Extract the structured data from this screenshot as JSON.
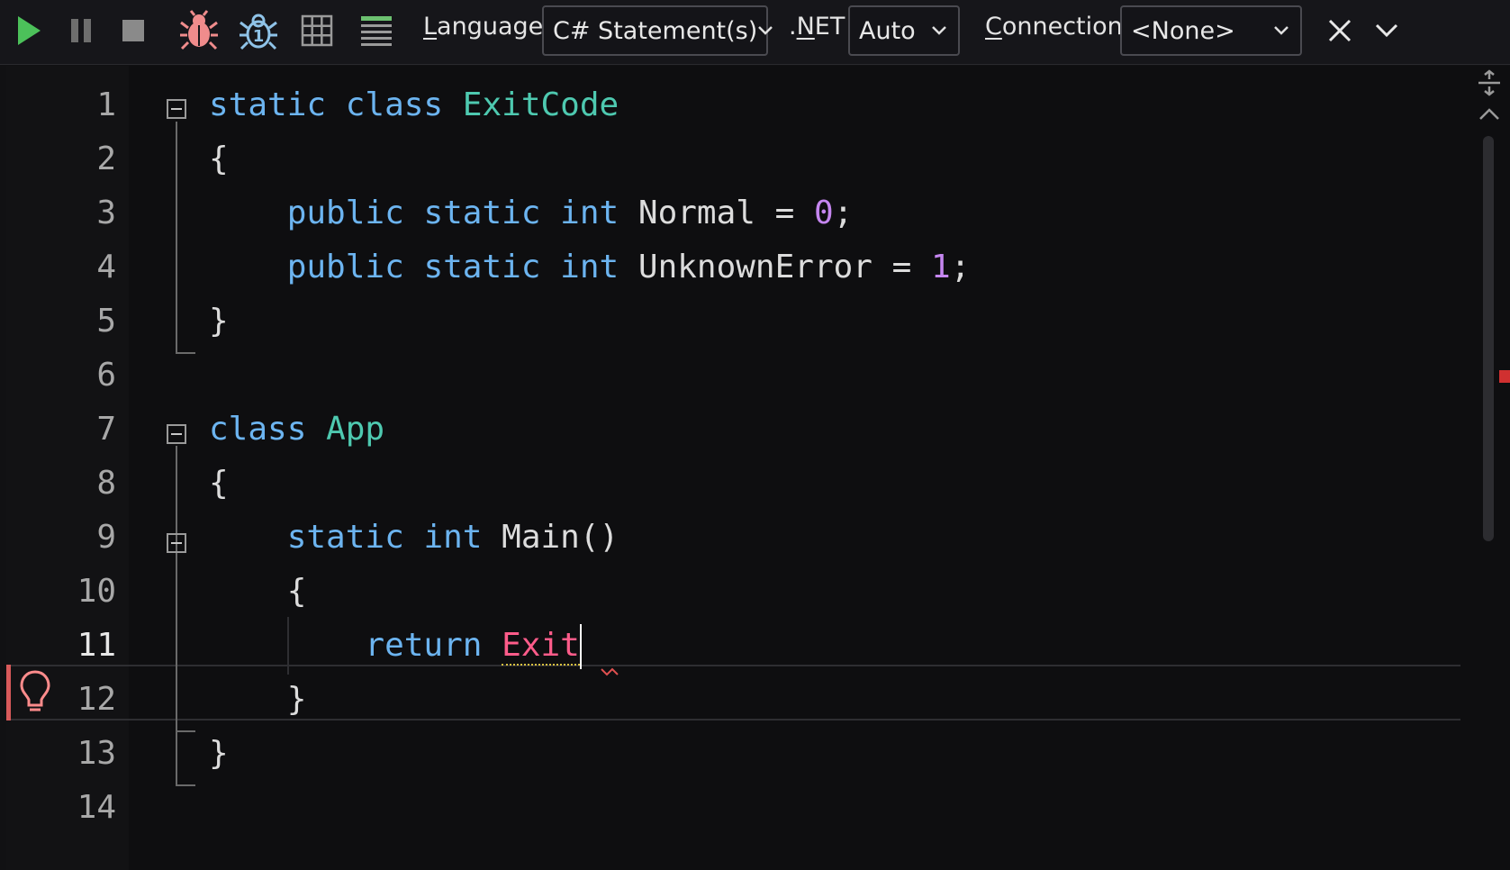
{
  "toolbar": {
    "language_label": "Language",
    "language_label_access": "L",
    "language_label_rest": "anguage",
    "language_value": "C# Statement(s)",
    "net_label": ".NET",
    "net_label_access": "N",
    "net_label_pre": ".",
    "net_label_rest": "ET",
    "net_value": "Auto",
    "connection_label": "Connection",
    "connection_label_access": "C",
    "connection_label_rest": "onnection",
    "connection_value": "<None>"
  },
  "icons": {
    "run": "play-icon",
    "pause": "pause-icon",
    "stop": "stop-icon",
    "debug": "bug-icon",
    "debug_step": "bug-step-icon",
    "grid": "grid-results-icon",
    "text": "text-results-icon",
    "close": "close-icon",
    "expand": "chevron-down-icon"
  },
  "colors": {
    "run_green": "#4cc15a",
    "keyword": "#6cb4f0",
    "type": "#4ec9b0",
    "number": "#c586f0",
    "error": "#ff5c8a",
    "bulb": "#ff8c8c"
  },
  "editor": {
    "lines": [
      {
        "n": "1"
      },
      {
        "n": "2"
      },
      {
        "n": "3"
      },
      {
        "n": "4"
      },
      {
        "n": "5"
      },
      {
        "n": "6"
      },
      {
        "n": "7"
      },
      {
        "n": "8"
      },
      {
        "n": "9"
      },
      {
        "n": "10"
      },
      {
        "n": "11"
      },
      {
        "n": "12"
      },
      {
        "n": "13"
      },
      {
        "n": "14"
      }
    ],
    "code": {
      "l1_static": "static",
      "l1_class": "class",
      "l1_name": "ExitCode",
      "l2": "{",
      "l3_public": "public",
      "l3_static": "static",
      "l3_int": "int",
      "l3_rest": "Normal = ",
      "l3_num": "0",
      "l3_end": ";",
      "l4_public": "public",
      "l4_static": "static",
      "l4_int": "int",
      "l4_rest": "UnknownError = ",
      "l4_num": "1",
      "l4_end": ";",
      "l5": "}",
      "l7_class": "class",
      "l7_name": "App",
      "l8": "{",
      "l9_static": "static",
      "l9_int": "int",
      "l9_rest": "Main()",
      "l10": "{",
      "l11_return": "return",
      "l11_err": "Exit",
      "l12": "}",
      "l13": "}"
    },
    "active_line": "11"
  }
}
